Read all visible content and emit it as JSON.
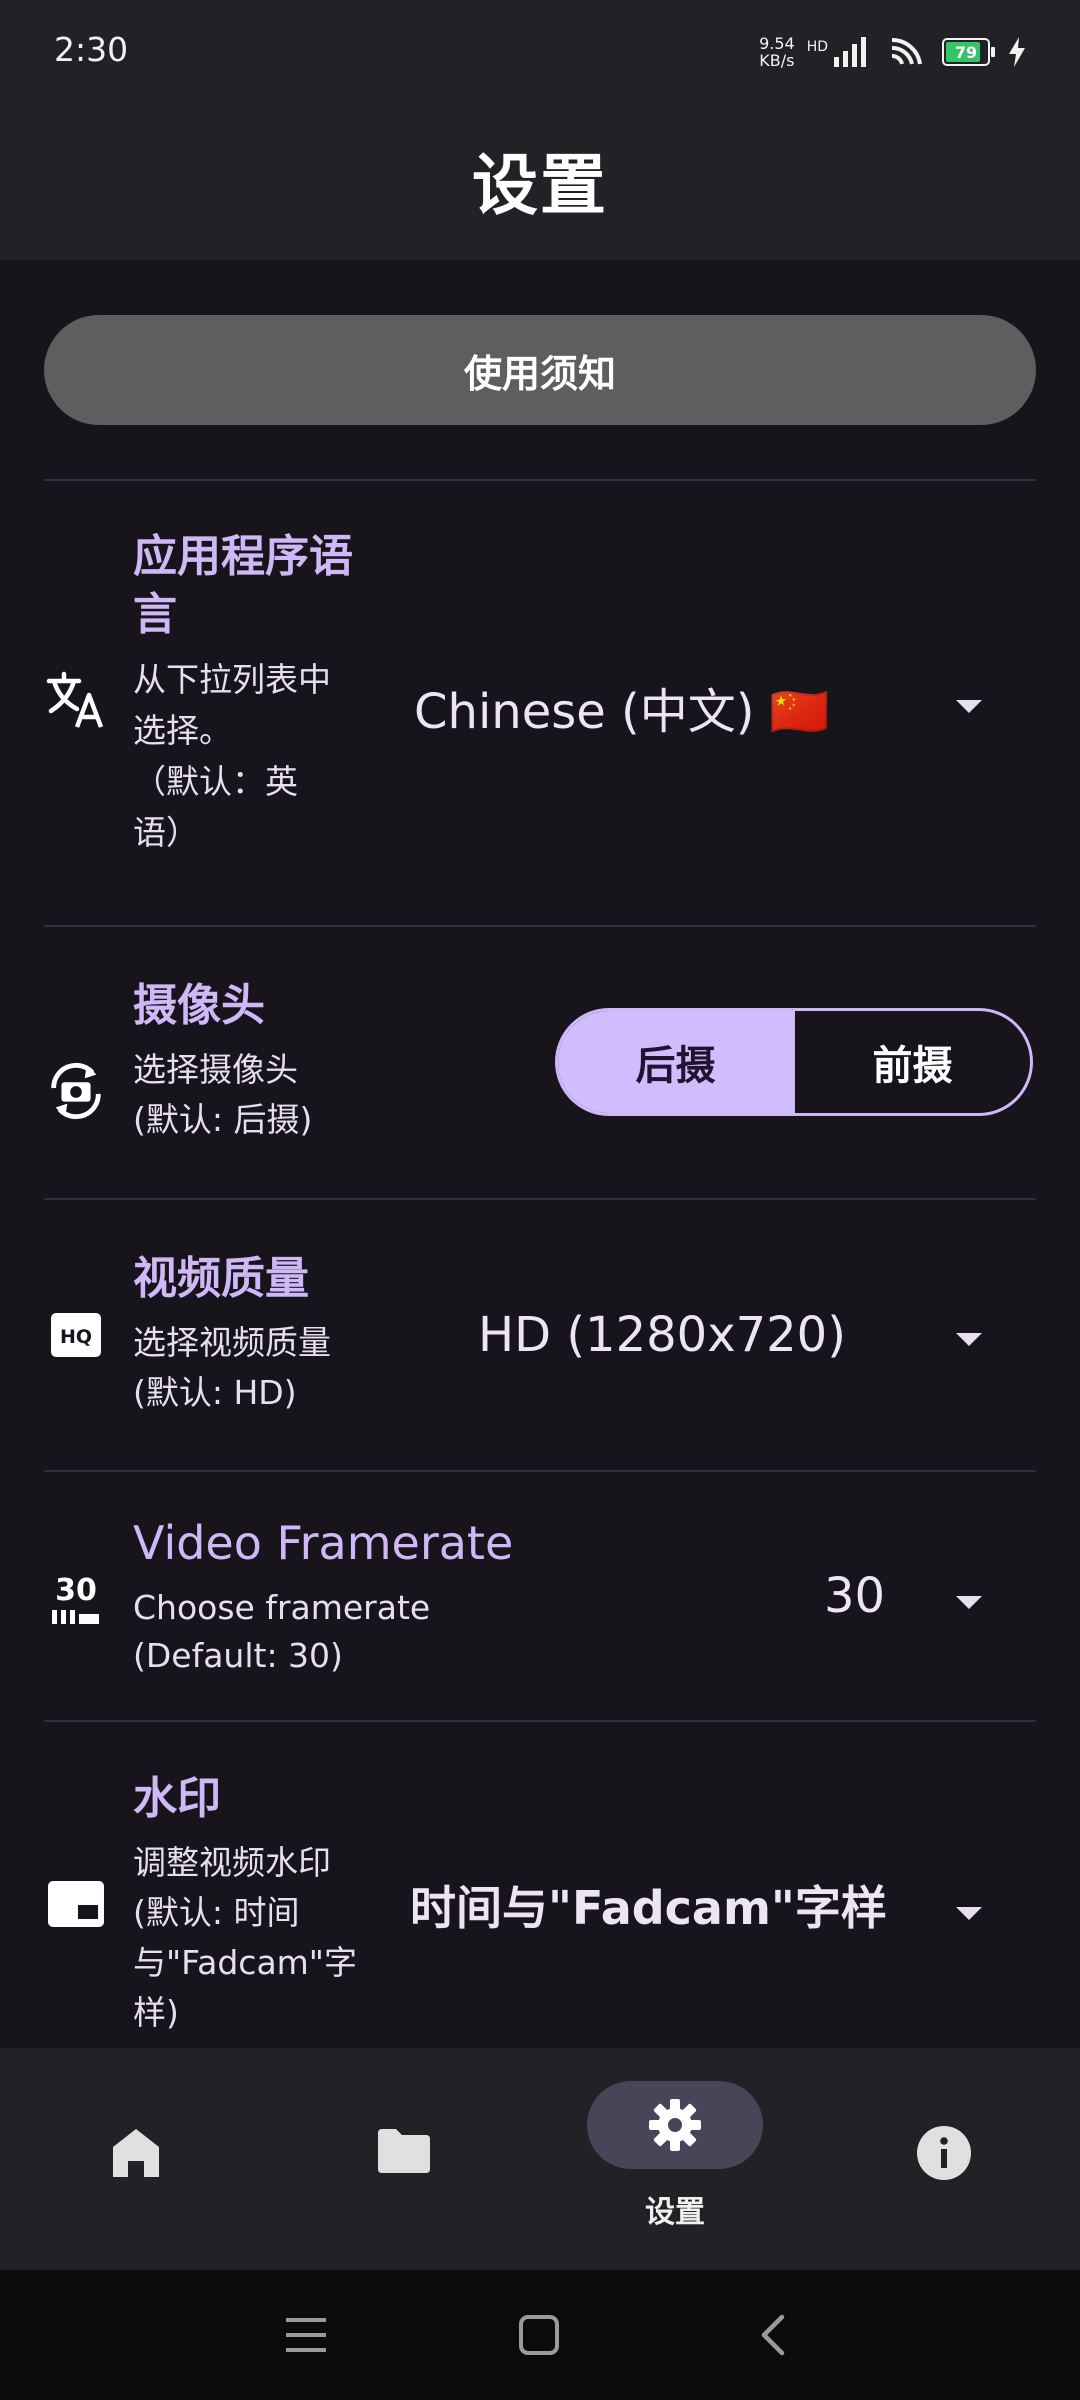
{
  "status_bar": {
    "time": "2:30",
    "net_speed_value": "9.54",
    "net_speed_unit": "KB/s",
    "network_type": "HD",
    "battery_level": "79"
  },
  "header": {
    "title": "设置"
  },
  "notice_button": {
    "label": "使用须知"
  },
  "settings": {
    "language": {
      "title_line1": "应用程序语",
      "title_line2": "言",
      "desc_line1": "从下拉列表中",
      "desc_line2": "选择。",
      "desc_line3": "（默认：英",
      "desc_line4": "语）",
      "value": "Chinese (中文) 🇨🇳"
    },
    "camera": {
      "title": "摄像头",
      "desc_line1": "选择摄像头",
      "desc_line2": "(默认: 后摄)",
      "options": [
        "后摄",
        "前摄"
      ],
      "selected": "后摄"
    },
    "video_quality": {
      "title": "视频质量",
      "desc_line1": "选择视频质量",
      "desc_line2": "(默认: HD)",
      "value": "HD (1280x720)"
    },
    "framerate": {
      "title": "Video Framerate",
      "desc_line1": "Choose framerate",
      "desc_line2": "(Default: 30)",
      "value": "30",
      "icon_text": "30"
    },
    "watermark": {
      "title": "水印",
      "desc_line1": "调整视频水印",
      "desc_line2": "(默认: 时间",
      "desc_line3": "与\"Fadcam\"字",
      "desc_line4": "样)",
      "value": "时间与\"Fadcam\"字样"
    }
  },
  "bottom_nav": {
    "items": [
      {
        "name": "home",
        "label": ""
      },
      {
        "name": "folder",
        "label": ""
      },
      {
        "name": "settings",
        "label": "设置",
        "active": true
      },
      {
        "name": "info",
        "label": ""
      }
    ]
  },
  "colors": {
    "background": "#17141c",
    "bar": "#222125",
    "accent": "#d0bcff",
    "title_purple": "#cfb8f5",
    "notice_button": "#5e5e5e"
  }
}
